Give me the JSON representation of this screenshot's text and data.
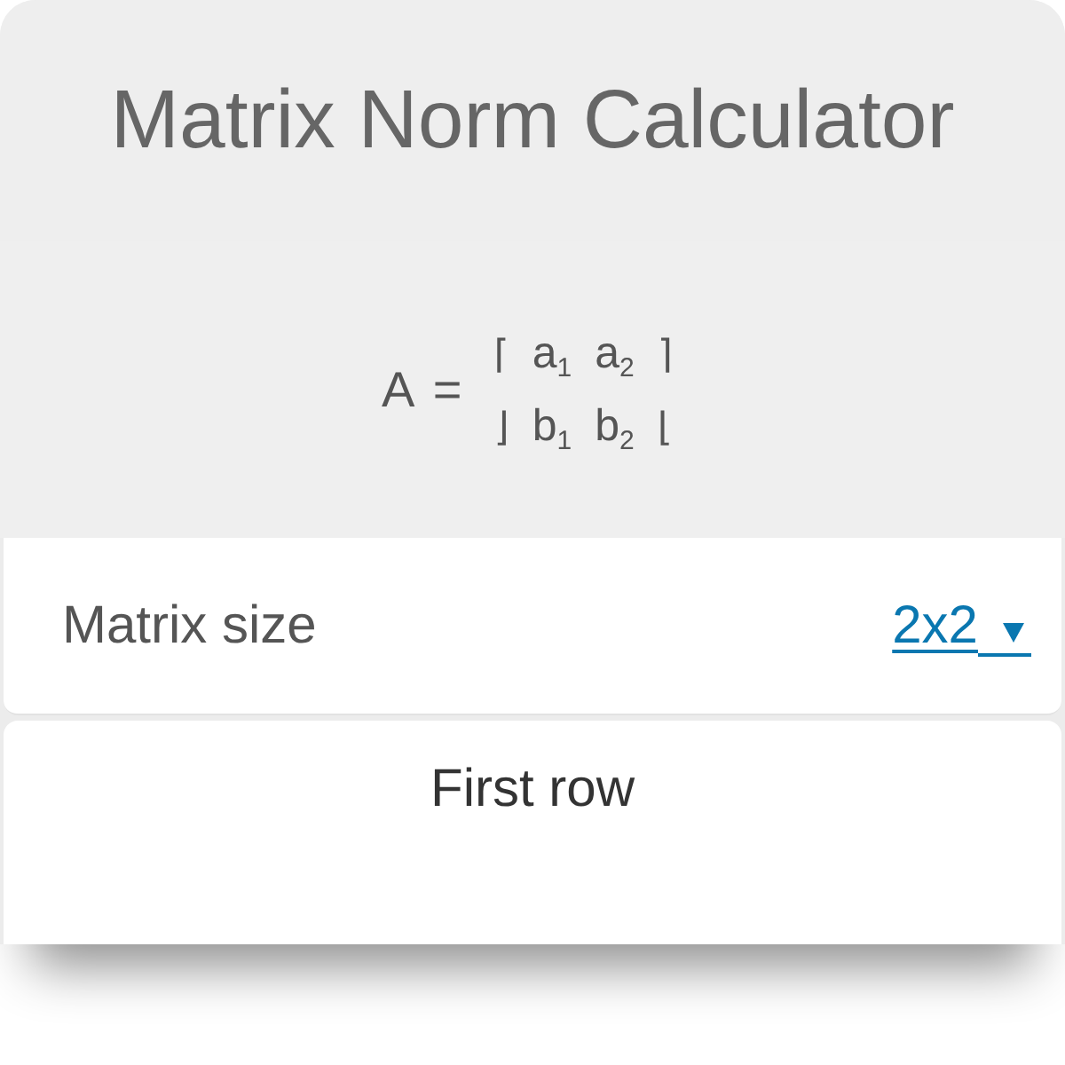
{
  "header": {
    "title": "Matrix Norm Calculator"
  },
  "formula": {
    "lhs": "A =",
    "rows": [
      {
        "open": "⌈",
        "cells": [
          "a$_{1}$",
          "a$_{2}$"
        ],
        "close": "⌉"
      },
      {
        "open": "⌋",
        "cells": [
          "b$_{1}$",
          "b$_{2}$"
        ],
        "close": "⌊"
      }
    ]
  },
  "fields": [
    {
      "kind": "dropdown",
      "label": "Matrix size",
      "value": "2x2"
    }
  ],
  "sections": [
    {
      "title": "First row"
    }
  ]
}
